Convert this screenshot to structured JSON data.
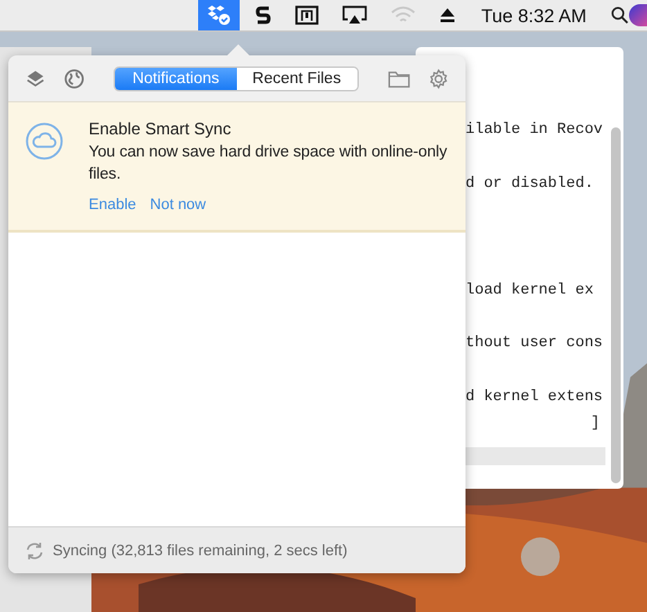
{
  "menu_bar": {
    "status_items": [
      {
        "kind": "dropbox",
        "selected": true
      },
      {
        "kind": "s-logo",
        "selected": false
      },
      {
        "kind": "display",
        "selected": false
      },
      {
        "kind": "airplay",
        "selected": false
      },
      {
        "kind": "wifi",
        "selected": false
      },
      {
        "kind": "eject",
        "selected": false
      }
    ],
    "clock": "Tue 8:32 AM"
  },
  "background_window": {
    "lines": [
      {
        "kind": "text",
        "text": "ilable in Recov"
      },
      {
        "kind": "blank"
      },
      {
        "kind": "text",
        "text": "d or disabled."
      },
      {
        "kind": "blank"
      },
      {
        "kind": "blank"
      },
      {
        "kind": "blank"
      },
      {
        "kind": "text",
        "text": "load kernel ex"
      },
      {
        "kind": "blank"
      },
      {
        "kind": "text",
        "text": "thout user cons"
      },
      {
        "kind": "blank"
      },
      {
        "kind": "text",
        "text": "d kernel extens"
      },
      {
        "kind": "bracket",
        "text": "]"
      },
      {
        "kind": "highlight"
      }
    ]
  },
  "popover": {
    "tabs": [
      {
        "label": "Notifications",
        "selected": true
      },
      {
        "label": "Recent Files",
        "selected": false
      }
    ],
    "notification": {
      "title": "Enable Smart Sync",
      "message": "You can now save hard drive space with online-only files.",
      "actions": [
        "Enable",
        "Not now"
      ]
    },
    "status": "Syncing (32,813 files remaining, 2 secs left)"
  }
}
